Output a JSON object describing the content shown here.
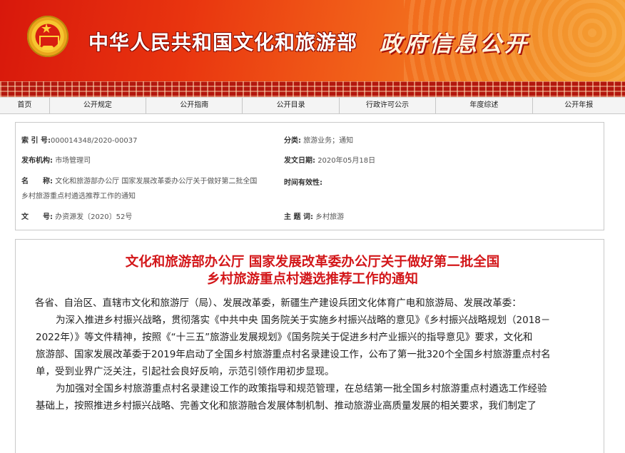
{
  "banner": {
    "ministry_name": "中华人民共和国文化和旅游部",
    "site_name": "政府信息公开",
    "emblem_icon": "national-emblem-icon"
  },
  "nav": {
    "items": [
      "首页",
      "公开规定",
      "公开指南",
      "公开目录",
      "行政许可公示",
      "年度综述",
      "公开年报"
    ]
  },
  "meta": {
    "index_no_label": "索 引 号:",
    "index_no_value": "000014348/2020-00037",
    "category_label": "分类:",
    "category_value": "旅游业务；通知",
    "issuer_label": "发布机构:",
    "issuer_value": "市场管理司",
    "issue_date_label": "发文日期:",
    "issue_date_value": "2020年05月18日",
    "name_label": "名　　称:",
    "name_value_line1": "文化和旅游部办公厅 国家发展改革委办公厅关于做好第二批全国",
    "name_value_line2": "乡村旅游重点村遴选推荐工作的通知",
    "effective_label": "时间有效性:",
    "doc_no_label": "文　　号:",
    "doc_no_value": "办资源发〔2020〕52号",
    "topic_label": "主 题 词:",
    "topic_value": "乡村旅游"
  },
  "article": {
    "title_line1": "文化和旅游部办公厅  国家发展改革委办公厅关于做好第二批全国",
    "title_line2": "乡村旅游重点村遴选推荐工作的通知",
    "salutation": "各省、自治区、直辖市文化和旅游厅（局）、发展改革委，新疆生产建设兵团文化体育广电和旅游局、发展改革委：",
    "para1_lines": [
      "为深入推进乡村振兴战略，贯彻落实《中共中央 国务院关于实施乡村振兴战略的意见》《乡村振兴战略规划（2018－",
      "2022年）》等文件精神，按照《“十三五”旅游业发展规划》《国务院关于促进乡村产业振兴的指导意见》要求，文化和",
      "旅游部、国家发展改革委于2019年启动了全国乡村旅游重点村名录建设工作，公布了第一批320个全国乡村旅游重点村名",
      "单，受到业界广泛关注，引起社会良好反响，示范引领作用初步显现。"
    ],
    "para2_lines": [
      "为加强对全国乡村旅游重点村名录建设工作的政策指导和规范管理，在总结第一批全国乡村旅游重点村遴选工作经验",
      "基础上，按照推进乡村振兴战略、完善文化和旅游融合发展体制机制、推动旅游业高质量发展的相关要求，我们制定了"
    ]
  }
}
